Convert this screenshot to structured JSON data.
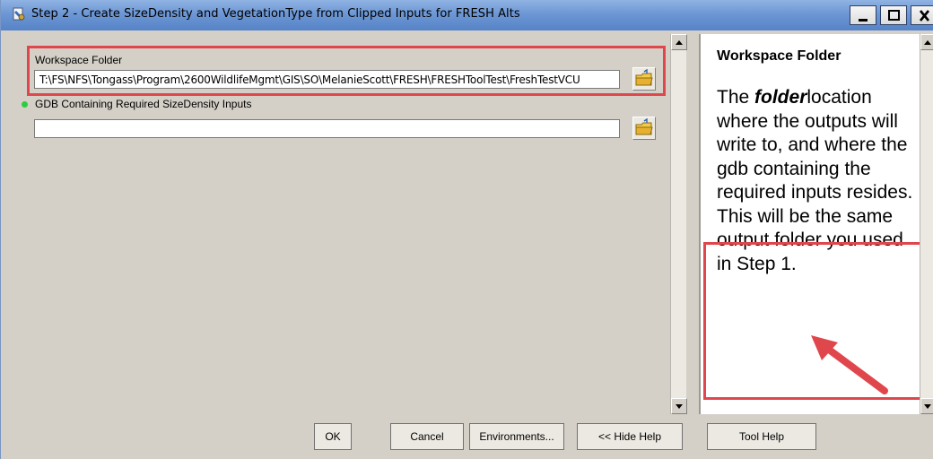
{
  "window": {
    "title": "Step 2 - Create SizeDensity and VegetationType from Clipped Inputs for FRESH Alts"
  },
  "params": {
    "workspace_label": "Workspace Folder",
    "workspace_value": "T:\\FS\\NFS\\Tongass\\Program\\2600WildlifeMgmt\\GIS\\SO\\MelanieScott\\FRESH\\FRESHToolTest\\FreshTestVCU",
    "gdb_label": "GDB Containing Required SizeDensity Inputs",
    "gdb_value": ""
  },
  "help": {
    "title": "Workspace Folder",
    "lead": "The ",
    "emph": "folder",
    "rest": "location where the outputs will write to, and where the gdb containing the required inputs resides. This will be the same output folder you used in Step 1."
  },
  "buttons": {
    "ok": "OK",
    "cancel": "Cancel",
    "environments": "Environments...",
    "hide_help": "<< Hide Help",
    "tool_help": "Tool Help"
  },
  "colors": {
    "highlight": "#e0474c",
    "title_bar": "#6d97d4",
    "dialog_bg": "#d4d0c8"
  },
  "icons": [
    "tool-icon",
    "minimize-icon",
    "maximize-icon",
    "close-icon",
    "folder-icon",
    "scroll-up-icon",
    "scroll-down-icon",
    "arrow-icon"
  ]
}
